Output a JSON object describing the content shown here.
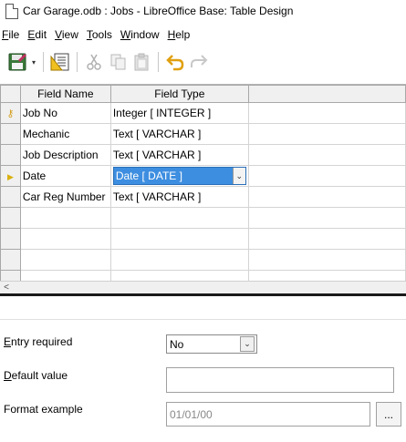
{
  "window": {
    "title": "Car Garage.odb : Jobs - LibreOffice Base: Table Design",
    "icon": "document-icon"
  },
  "menubar": [
    {
      "id": "file",
      "mnemonic": "F",
      "rest": "ile"
    },
    {
      "id": "edit",
      "mnemonic": "E",
      "rest": "dit"
    },
    {
      "id": "view",
      "mnemonic": "V",
      "rest": "iew"
    },
    {
      "id": "tools",
      "mnemonic": "T",
      "rest": "ools"
    },
    {
      "id": "window",
      "mnemonic": "W",
      "rest": "indow"
    },
    {
      "id": "help",
      "mnemonic": "H",
      "rest": "elp"
    }
  ],
  "toolbar": {
    "icons": [
      "save-icon",
      "dropdown-arrow",
      "index-design-icon",
      "cut-icon",
      "copy-icon",
      "paste-icon",
      "undo-icon",
      "redo-icon"
    ],
    "dropdown_glyph": "▾"
  },
  "table": {
    "columns": {
      "name": "Field Name",
      "type": "Field Type"
    },
    "rows": [
      {
        "name": "Job No",
        "type": "Integer [ INTEGER ]",
        "marker": "⚷"
      },
      {
        "name": "Mechanic",
        "type": "Text [ VARCHAR ]",
        "marker": ""
      },
      {
        "name": "Job Description",
        "type": "Text [ VARCHAR ]",
        "marker": ""
      },
      {
        "name": "Date",
        "type": "Date [ DATE ]",
        "marker": "▶"
      },
      {
        "name": "Car Reg Number",
        "type": "Text [ VARCHAR ]",
        "marker": ""
      }
    ],
    "dropdown_glyph": "⌄",
    "selected_row": 3
  },
  "scrollbar": {
    "left_glyph": "<"
  },
  "properties": {
    "entry_required": {
      "mnemonic": "E",
      "rest": "ntry required",
      "value": "No",
      "arrow": "⌄"
    },
    "default_value": {
      "mnemonic": "D",
      "rest": "efault value",
      "value": ""
    },
    "format_example": {
      "label": "Format example",
      "value": "01/01/00",
      "button": "..."
    }
  },
  "colors": {
    "selection": "#3d8ee0",
    "key_marker": "#d4a020"
  }
}
